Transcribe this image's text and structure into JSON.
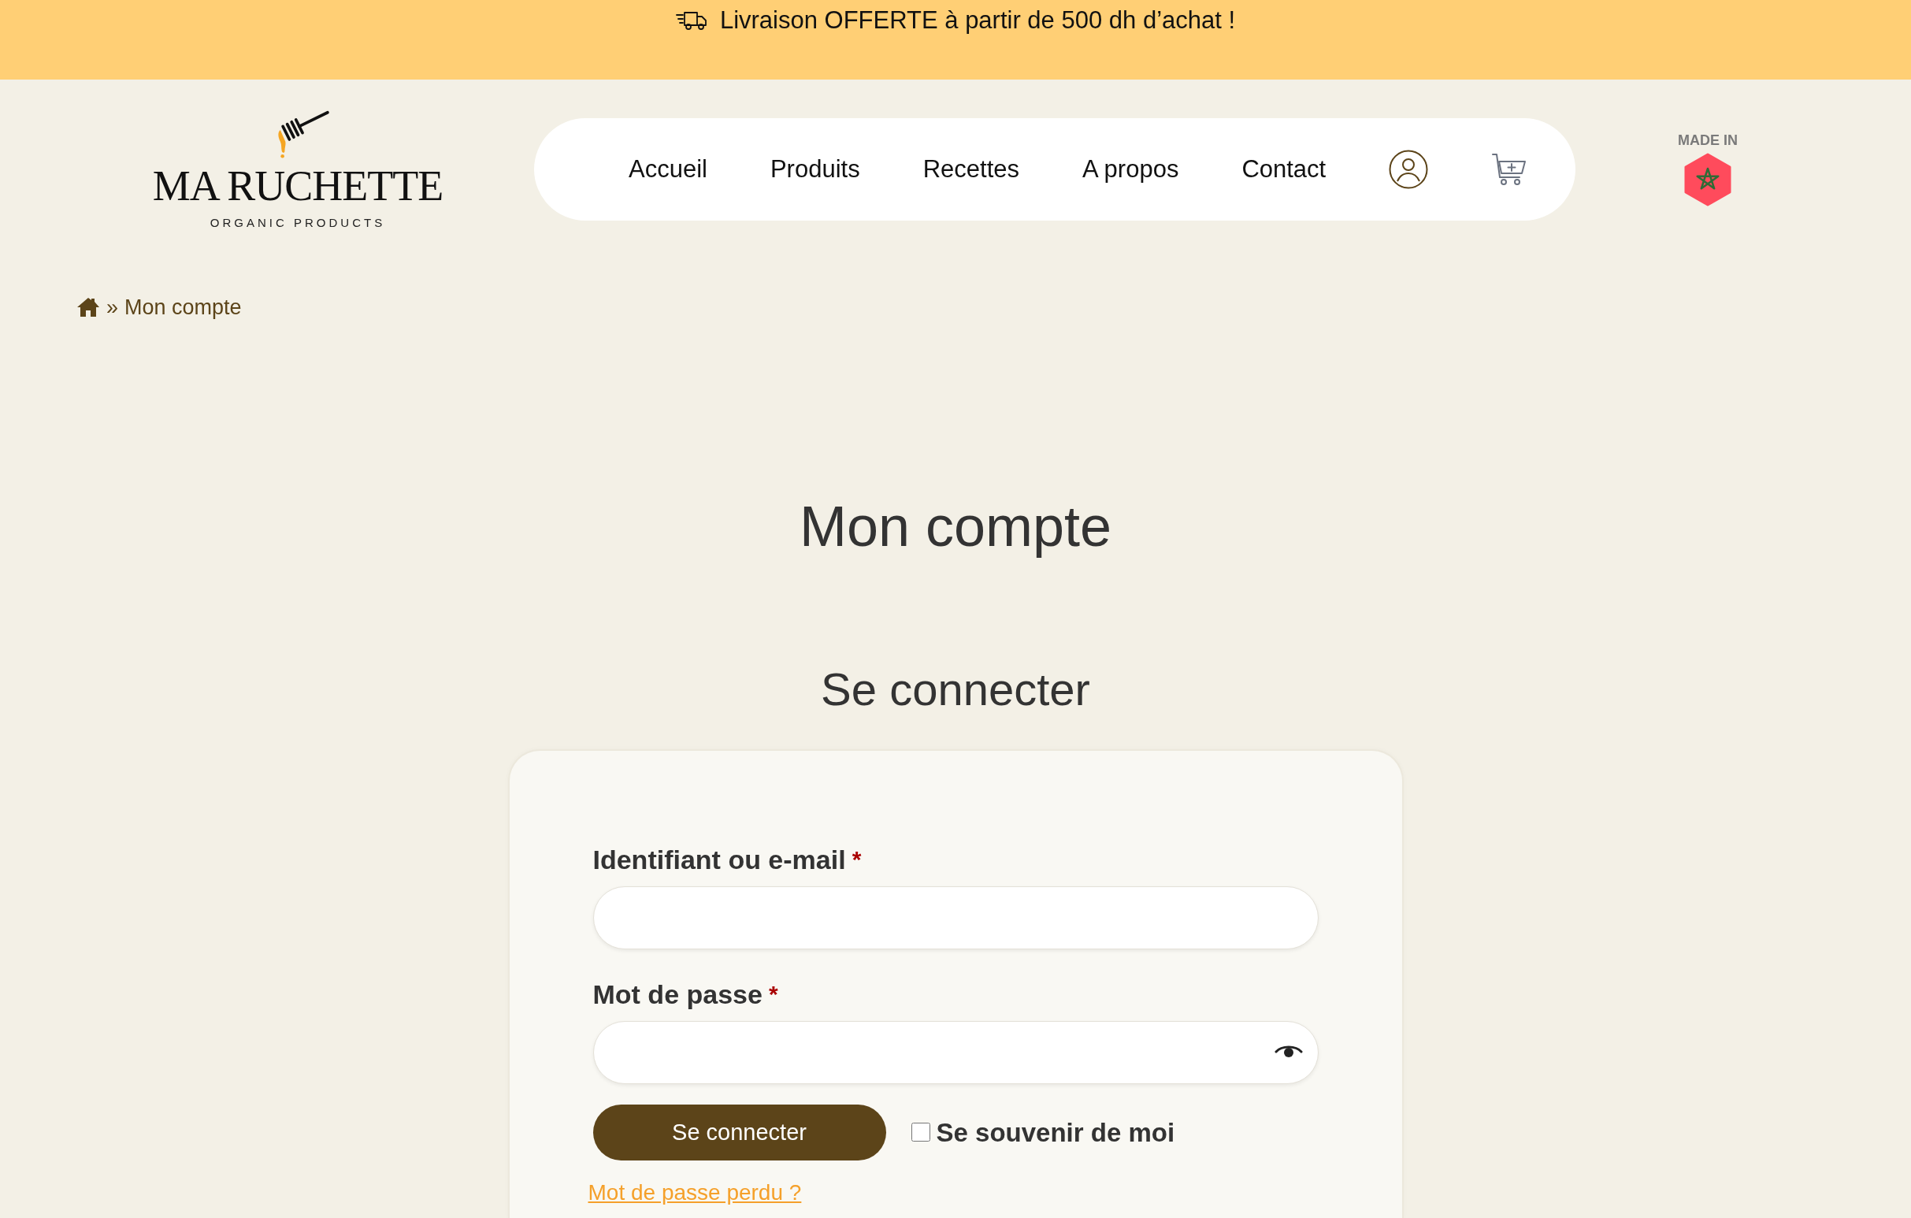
{
  "announcement_bar": {
    "text": "Livraison OFFERTE à partir de 500 dh d’achat !"
  },
  "logo": {
    "name": "MA RUCHETTE",
    "tagline": "ORGANIC PRODUCTS"
  },
  "nav_items": [
    "Accueil",
    "Produits",
    "Recettes",
    "A propos",
    "Contact"
  ],
  "made_in_badge": {
    "label": "MADE IN"
  },
  "breadcrumb": {
    "separator": "»",
    "current": "Mon compte"
  },
  "page_title": "Mon compte",
  "login": {
    "title": "Se connecter",
    "fields": [
      {
        "kind": "text",
        "label": "Identifiant ou e-mail",
        "required_mark": "*"
      },
      {
        "kind": "password",
        "label": "Mot de passe",
        "required_mark": "*"
      }
    ],
    "submit": "Se connecter",
    "remember_me": {
      "label": "Se souvenir de moi",
      "checked": false
    },
    "lost_password": "Mot de passe perdu ?"
  }
}
